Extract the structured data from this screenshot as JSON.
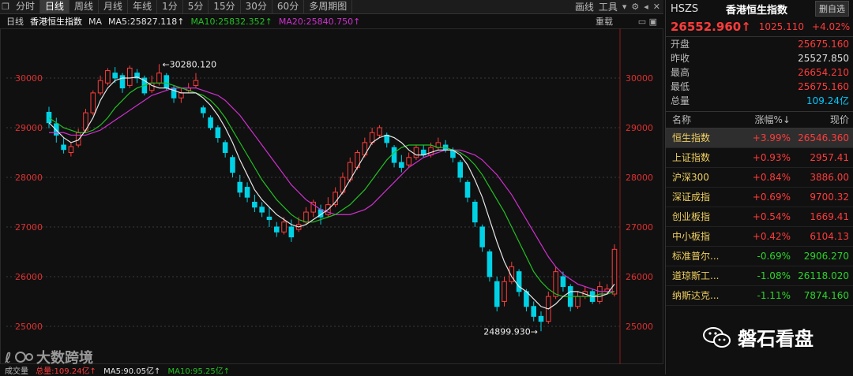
{
  "toolbar": {
    "items": [
      "分时",
      "日线",
      "周线",
      "月线",
      "年线",
      "1分",
      "5分",
      "15分",
      "30分",
      "60分",
      "多周期图"
    ],
    "active_index": 1,
    "right": {
      "draw": "画线",
      "tools": "工具"
    }
  },
  "info": {
    "period": "日线",
    "name": "香港恒生指数",
    "ma_label": "MA",
    "ma5": "MA5:25827.118↑",
    "ma10": "MA10:25832.352↑",
    "ma20": "MA20:25840.750↑",
    "reset": "重载"
  },
  "colors": {
    "up": "#ff3b3b",
    "down": "#00d2e6",
    "ma5": "#e6e6e6",
    "ma10": "#22c022",
    "ma20": "#d030d0",
    "axis_text": "#e03030",
    "grid": "#3a3a3a"
  },
  "chart_data": {
    "type": "candlestick",
    "ylim": [
      24650,
      31000
    ],
    "y_ticks": [
      25000,
      26000,
      27000,
      28000,
      29000,
      30000
    ],
    "y_tick_labels": [
      "25000",
      "26000",
      "27000",
      "28000",
      "29000",
      "30000"
    ],
    "annotations": {
      "high": "←30280.120",
      "low": "24899.930→"
    },
    "candles": [
      [
        29310,
        29100,
        29420,
        28990
      ],
      [
        29080,
        28850,
        29200,
        28700
      ],
      [
        28650,
        28560,
        28800,
        28480
      ],
      [
        28500,
        28620,
        28700,
        28420
      ],
      [
        28650,
        28900,
        28980,
        28600
      ],
      [
        28950,
        29300,
        29380,
        28900
      ],
      [
        29300,
        29700,
        29750,
        29250
      ],
      [
        29700,
        29950,
        30050,
        29650
      ],
      [
        29900,
        30150,
        30200,
        29850
      ],
      [
        30100,
        30000,
        30220,
        29900
      ],
      [
        30050,
        29800,
        30100,
        29700
      ],
      [
        29850,
        30200,
        30250,
        29800
      ],
      [
        30100,
        30000,
        30180,
        29900
      ],
      [
        30000,
        29700,
        30050,
        29650
      ],
      [
        29750,
        29900,
        30050,
        29700
      ],
      [
        29900,
        30100,
        30280,
        29850
      ],
      [
        30050,
        29800,
        30100,
        29750
      ],
      [
        29800,
        29600,
        29850,
        29500
      ],
      [
        29600,
        29700,
        29800,
        29500
      ],
      [
        29750,
        29800,
        29900,
        29700
      ],
      [
        29850,
        29950,
        30100,
        29800
      ],
      [
        29400,
        29300,
        29450,
        29200
      ],
      [
        29200,
        29000,
        29250,
        28950
      ],
      [
        29000,
        28800,
        29050,
        28700
      ],
      [
        28700,
        28500,
        28750,
        28400
      ],
      [
        28400,
        28100,
        28450,
        28000
      ],
      [
        27900,
        27700,
        28050,
        27600
      ],
      [
        27800,
        27600,
        27900,
        27500
      ],
      [
        27500,
        27400,
        27650,
        27300
      ],
      [
        27400,
        27300,
        27500,
        27200
      ],
      [
        27200,
        27150,
        27400,
        27000
      ],
      [
        27000,
        26900,
        27100,
        26800
      ],
      [
        26900,
        27100,
        27200,
        26850
      ],
      [
        27000,
        26800,
        27150,
        26700
      ],
      [
        26950,
        27050,
        27200,
        26900
      ],
      [
        27100,
        27300,
        27400,
        27050
      ],
      [
        27300,
        27500,
        27550,
        27200
      ],
      [
        27350,
        27200,
        27450,
        27050
      ],
      [
        27250,
        27450,
        27600,
        27200
      ],
      [
        27450,
        27700,
        27800,
        27400
      ],
      [
        27700,
        28000,
        28100,
        27650
      ],
      [
        27950,
        28300,
        28400,
        27900
      ],
      [
        28200,
        28500,
        28550,
        28150
      ],
      [
        28450,
        28700,
        28800,
        28400
      ],
      [
        28700,
        28900,
        29000,
        28650
      ],
      [
        28850,
        29000,
        29050,
        28800
      ],
      [
        28850,
        28700,
        28900,
        28600
      ],
      [
        28600,
        28300,
        28650,
        28200
      ],
      [
        28300,
        28200,
        28450,
        28100
      ],
      [
        28250,
        28400,
        28500,
        28200
      ],
      [
        28400,
        28600,
        28650,
        28350
      ],
      [
        28550,
        28450,
        28650,
        28400
      ],
      [
        28450,
        28600,
        28700,
        28400
      ],
      [
        28600,
        28700,
        28800,
        28550
      ],
      [
        28650,
        28550,
        28750,
        28500
      ],
      [
        28550,
        28400,
        28600,
        28300
      ],
      [
        28300,
        28000,
        28350,
        27900
      ],
      [
        27900,
        27600,
        27950,
        27500
      ],
      [
        27500,
        27100,
        27550,
        27000
      ],
      [
        27000,
        26600,
        27050,
        26500
      ],
      [
        26500,
        26000,
        26550,
        25900
      ],
      [
        25900,
        25400,
        26000,
        25300
      ],
      [
        25500,
        25900,
        26000,
        25400
      ],
      [
        25900,
        26200,
        26300,
        25850
      ],
      [
        26100,
        25700,
        26150,
        25600
      ],
      [
        25700,
        25400,
        25750,
        25300
      ],
      [
        25400,
        25200,
        25500,
        25100
      ],
      [
        25200,
        25100,
        25300,
        24900
      ],
      [
        25100,
        25600,
        25700,
        25050
      ],
      [
        25600,
        26100,
        26200,
        25550
      ],
      [
        26000,
        25800,
        26100,
        25700
      ],
      [
        25800,
        25400,
        25850,
        25300
      ],
      [
        25400,
        25600,
        25700,
        25350
      ],
      [
        25600,
        25700,
        25800,
        25550
      ],
      [
        25700,
        25500,
        25750,
        25450
      ],
      [
        25500,
        25800,
        25900,
        25450
      ],
      [
        25700,
        25750,
        25850,
        25650
      ],
      [
        25650,
        26550,
        26650,
        25600
      ]
    ],
    "ma5": [
      29100,
      28950,
      28800,
      28700,
      28750,
      28950,
      29200,
      29550,
      29800,
      29950,
      30000,
      30000,
      30020,
      29950,
      29850,
      29800,
      29800,
      29750,
      29700,
      29700,
      29700,
      29600,
      29450,
      29250,
      29000,
      28700,
      28350,
      28050,
      27750,
      27550,
      27400,
      27250,
      27150,
      27050,
      27000,
      27050,
      27150,
      27250,
      27350,
      27500,
      27700,
      27950,
      28200,
      28450,
      28700,
      28800,
      28850,
      28800,
      28700,
      28550,
      28450,
      28450,
      28500,
      28550,
      28550,
      28550,
      28450,
      28250,
      27950,
      27600,
      27150,
      26700,
      26300,
      26000,
      25800,
      25700,
      25550,
      25400,
      25350,
      25450,
      25600,
      25700,
      25700,
      25650,
      25600,
      25600,
      25650,
      25850
    ],
    "ma10": [
      29200,
      29100,
      29000,
      28950,
      28900,
      28900,
      28950,
      29050,
      29200,
      29400,
      29550,
      29700,
      29800,
      29850,
      29900,
      29900,
      29900,
      29850,
      29800,
      29750,
      29700,
      29650,
      29550,
      29400,
      29200,
      28950,
      28700,
      28450,
      28200,
      27950,
      27750,
      27550,
      27400,
      27250,
      27150,
      27100,
      27100,
      27150,
      27200,
      27250,
      27350,
      27450,
      27600,
      27750,
      27950,
      28150,
      28350,
      28500,
      28600,
      28650,
      28650,
      28650,
      28650,
      28600,
      28600,
      28550,
      28500,
      28400,
      28250,
      28050,
      27800,
      27550,
      27300,
      27000,
      26700,
      26400,
      26100,
      25900,
      25750,
      25650,
      25600,
      25600,
      25600,
      25600,
      25600,
      25650,
      25650,
      25700
    ],
    "ma20": [
      28900,
      28900,
      28900,
      28850,
      28850,
      28850,
      28900,
      28950,
      29050,
      29150,
      29250,
      29350,
      29450,
      29550,
      29650,
      29700,
      29750,
      29800,
      29800,
      29800,
      29800,
      29750,
      29700,
      29650,
      29550,
      29400,
      29250,
      29050,
      28850,
      28650,
      28450,
      28250,
      28050,
      27850,
      27700,
      27550,
      27450,
      27350,
      27300,
      27250,
      27250,
      27250,
      27300,
      27350,
      27450,
      27600,
      27750,
      27900,
      28050,
      28200,
      28300,
      28400,
      28450,
      28500,
      28550,
      28550,
      28550,
      28500,
      28450,
      28350,
      28200,
      28050,
      27850,
      27650,
      27400,
      27150,
      26900,
      26650,
      26400,
      26200,
      26050,
      25950,
      25850,
      25800,
      25750,
      25700,
      25700,
      25700
    ]
  },
  "panel": {
    "code": "HSZS",
    "name": "香港恒生指数",
    "delete_btn": "删自选",
    "price": "26552.960↑",
    "change": "1025.110",
    "pct": "+4.02%",
    "stats": [
      {
        "k": "开盘",
        "v": "25675.160",
        "cls": "red"
      },
      {
        "k": "昨收",
        "v": "25527.850",
        "cls": "white"
      },
      {
        "k": "最高",
        "v": "26654.210",
        "cls": "red"
      },
      {
        "k": "最低",
        "v": "25675.160",
        "cls": "red"
      },
      {
        "k": "总量",
        "v": "109.24亿",
        "cls": "cyan"
      }
    ],
    "table_header": {
      "name": "名称",
      "pct": "涨幅%↓",
      "price": "现价"
    },
    "rows": [
      {
        "name": "恒生指数",
        "pct": "+3.99%",
        "price": "26546.360",
        "dir": "up"
      },
      {
        "name": "上证指数",
        "pct": "+0.93%",
        "price": "2957.41",
        "dir": "up"
      },
      {
        "name": "沪深300",
        "pct": "+0.84%",
        "price": "3886.00",
        "dir": "up"
      },
      {
        "name": "深证成指",
        "pct": "+0.69%",
        "price": "9700.32",
        "dir": "up"
      },
      {
        "name": "创业板指",
        "pct": "+0.54%",
        "price": "1669.41",
        "dir": "up"
      },
      {
        "name": "中小板指",
        "pct": "+0.42%",
        "price": "6104.13",
        "dir": "up"
      },
      {
        "name": "标准普尔...",
        "pct": "-0.69%",
        "price": "2906.270",
        "dir": "dn"
      },
      {
        "name": "道琼斯工...",
        "pct": "-1.08%",
        "price": "26118.020",
        "dir": "dn"
      },
      {
        "name": "纳斯达克...",
        "pct": "-1.11%",
        "price": "7874.160",
        "dir": "dn"
      }
    ]
  },
  "watermark": {
    "text": "磐石看盘"
  },
  "logo": {
    "text": "大数跨境"
  },
  "bottombar": {
    "vol": "成交量",
    "total": "总量:109.24亿↑",
    "ma5": "MA5:90.05亿↑",
    "ma10": "MA10:95.25亿↑"
  }
}
